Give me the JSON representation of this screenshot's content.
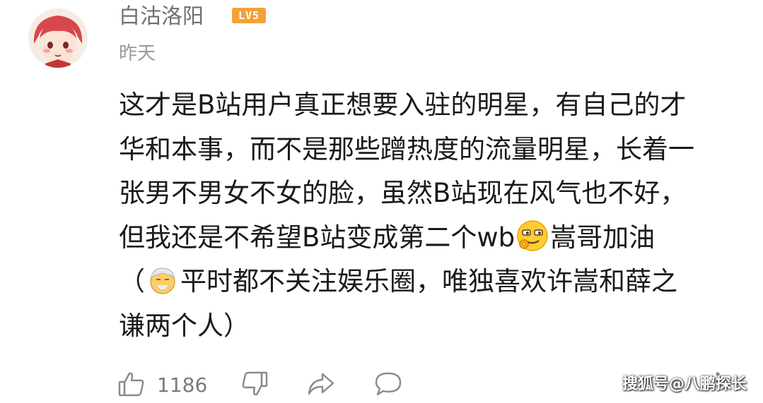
{
  "comment": {
    "username": "白沽洛阳",
    "level": "LV5",
    "timestamp": "昨天",
    "text_lines": {
      "l1": "这才是B站用户真正想要入驻的明星，有自己的才",
      "l2": "华和本事，而不是那些蹭热度的流量明星，长着一",
      "l3": "张男不男女不女的脸，虽然B站现在风气也不好，",
      "l4_before": "但我还是不希望B站变成第二个wb",
      "l4_after": "嵩哥加油",
      "l5_before": "（",
      "l5_after": "平时都不关注娱乐圈，唯独喜欢许嵩和薛之",
      "l6": "谦两个人）"
    },
    "emojis": {
      "first": "smirk-ok-emoji",
      "second": "old-man-emoji"
    }
  },
  "actions": {
    "like_count": "1186",
    "icons": [
      "thumbs-up-icon",
      "thumbs-down-icon",
      "share-icon",
      "comment-icon"
    ]
  },
  "watermark": "搜狐号@八鹏探长",
  "colors": {
    "username": "#707070",
    "timestamp": "#9a9a9a",
    "level_badge": "#f2a13a",
    "icon_gray": "#8a8a8a"
  }
}
